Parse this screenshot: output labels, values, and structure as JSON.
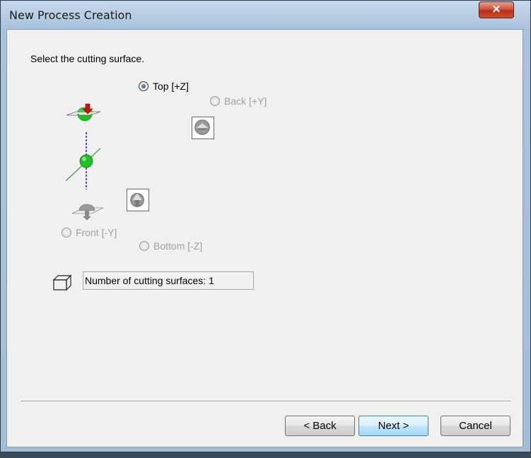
{
  "window": {
    "title": "New Process Creation",
    "close_glyph": "✕"
  },
  "instruction": "Select the cutting surface.",
  "surfaces": {
    "top": {
      "label": "Top [+Z]",
      "checked": true,
      "enabled": true
    },
    "back": {
      "label": "Back [+Y]",
      "checked": false,
      "enabled": false
    },
    "front": {
      "label": "Front [-Y]",
      "checked": false,
      "enabled": false
    },
    "bottom": {
      "label": "Bottom [-Z]",
      "checked": false,
      "enabled": false
    }
  },
  "count_field": {
    "value": "Number of cutting surfaces: 1"
  },
  "buttons": {
    "back": "< Back",
    "next": "Next >",
    "cancel": "Cancel"
  },
  "colors": {
    "sphere": "#22c022",
    "arrow": "#d01010",
    "z_axis": "#1a1acc",
    "y_axis": "#2a9a2a"
  }
}
